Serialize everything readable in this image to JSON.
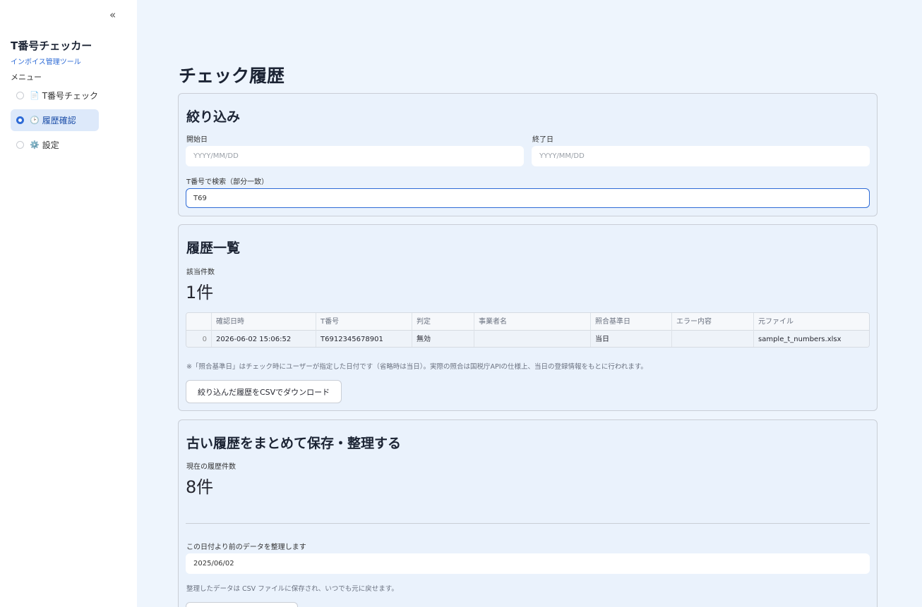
{
  "sidebar": {
    "collapse_icon": "«",
    "app_title": "T番号チェッカー",
    "app_subtitle": "インボイス管理ツール",
    "menu_label": "メニュー",
    "items": [
      {
        "icon": "📄",
        "icon_name": "document-icon",
        "label": "T番号チェック",
        "selected": false
      },
      {
        "icon": "🕑",
        "icon_name": "clock-icon",
        "label": "履歴確認",
        "selected": true
      },
      {
        "icon": "⚙️",
        "icon_name": "gear-icon",
        "label": "設定",
        "selected": false
      }
    ]
  },
  "page": {
    "title": "チェック履歴"
  },
  "filter": {
    "heading": "絞り込み",
    "start_label": "開始日",
    "start_placeholder": "YYYY/MM/DD",
    "end_label": "終了日",
    "end_placeholder": "YYYY/MM/DD",
    "search_label": "T番号で検索（部分一致）",
    "search_value": "T69"
  },
  "history": {
    "heading": "履歴一覧",
    "count_label": "該当件数",
    "count_value": "1件",
    "columns": [
      "",
      "確認日時",
      "T番号",
      "判定",
      "事業者名",
      "照合基準日",
      "エラー内容",
      "元ファイル"
    ],
    "rows": [
      [
        "0",
        "2026-06-02 15:06:52",
        "T6912345678901",
        "無効",
        "",
        "当日",
        "",
        "sample_t_numbers.xlsx"
      ]
    ],
    "note": "※「照合基準日」はチェック時にユーザーが指定した日付です（省略時は当日）。実際の照合は国税庁APIの仕様上、当日の登録情報をもとに行われます。",
    "download_button": "絞り込んだ履歴をCSVでダウンロード"
  },
  "archive": {
    "heading": "古い履歴をまとめて保存・整理する",
    "count_label": "現在の履歴件数",
    "count_value": "8件",
    "date_label": "この日付より前のデータを整理します",
    "date_value": "2025/06/02",
    "note": "整理したデータは CSV ファイルに保存され、いつでも元に戻せます。"
  },
  "colors": {
    "accent": "#2e6bd6",
    "background": "#eef5fd",
    "sidebar": "#ffffff"
  }
}
